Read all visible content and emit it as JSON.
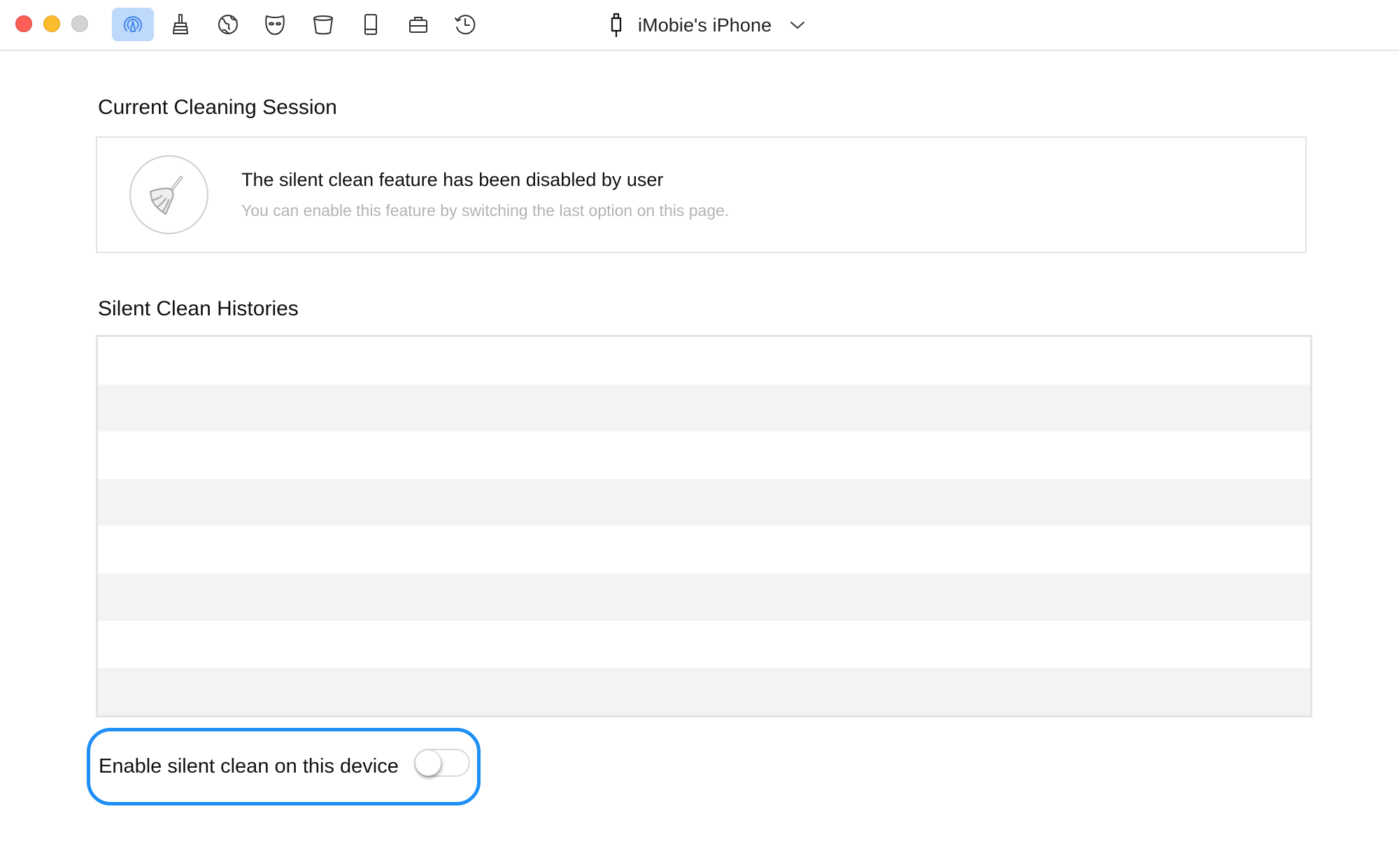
{
  "window": {
    "controls": [
      "close",
      "minimize",
      "zoom"
    ]
  },
  "toolbar": {
    "tools": [
      {
        "icon": "airplay-signal-icon",
        "label": "Silent Clean",
        "active": true
      },
      {
        "icon": "brush-icon",
        "label": "Clean",
        "active": false
      },
      {
        "icon": "globe-icon",
        "label": "Internet",
        "active": false
      },
      {
        "icon": "mask-icon",
        "label": "Privacy",
        "active": false
      },
      {
        "icon": "bucket-icon",
        "label": "Trash",
        "active": false
      },
      {
        "icon": "phone-icon",
        "label": "Device",
        "active": false
      },
      {
        "icon": "briefcase-icon",
        "label": "Toolbox",
        "active": false
      },
      {
        "icon": "history-icon",
        "label": "History",
        "active": false
      }
    ],
    "accent_color": "#bed9fb"
  },
  "device": {
    "name": "iMobie's iPhone",
    "icon": "lightning-cable-icon"
  },
  "session": {
    "heading": "Current Cleaning Session",
    "icon": "broom-icon",
    "title": "The silent clean feature has been disabled by user",
    "subtitle": "You can enable this feature by switching the last option on this page."
  },
  "histories": {
    "heading": "Silent Clean Histories",
    "rows": [
      {
        "text": ""
      },
      {
        "text": ""
      },
      {
        "text": ""
      },
      {
        "text": ""
      },
      {
        "text": ""
      },
      {
        "text": ""
      },
      {
        "text": ""
      },
      {
        "text": ""
      }
    ]
  },
  "option": {
    "label": "Enable silent clean on this device",
    "enabled": false,
    "highlight_color": "#1e8ff5"
  }
}
